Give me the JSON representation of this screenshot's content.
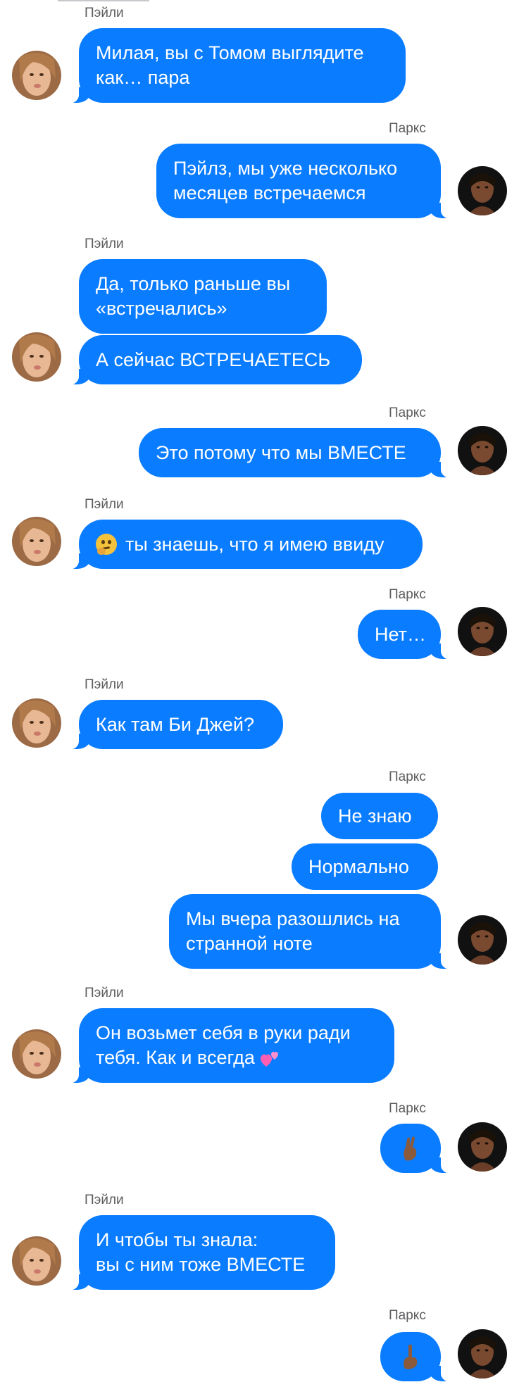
{
  "contacts": {
    "left_name": "Пэйли",
    "right_name": "Паркс"
  },
  "colors": {
    "bubble": "#0a7cff",
    "name_text": "#5c5c5f",
    "background": "#ffffff"
  },
  "messages": [
    {
      "sender": "Пэйли",
      "lines": [
        "Милая, вы с Томом выглядите",
        "как… пара"
      ]
    },
    {
      "sender": "Паркс",
      "lines": [
        "Пэйлз, мы уже несколько",
        "месяцев встречаемся"
      ]
    },
    {
      "sender": "Пэйли",
      "lines": [
        "Да, только раньше вы",
        "«встречались»"
      ]
    },
    {
      "sender": "Пэйли",
      "lines": [
        "А сейчас ВСТРЕЧАЕТЕСЬ"
      ]
    },
    {
      "sender": "Паркс",
      "lines": [
        "Это потому что мы ВМЕСТЕ"
      ]
    },
    {
      "sender": "Пэйли",
      "emoji": "thinking-face",
      "lines": [
        "ты знаешь, что я имею ввиду"
      ]
    },
    {
      "sender": "Паркс",
      "lines": [
        "Нет…"
      ]
    },
    {
      "sender": "Пэйли",
      "lines": [
        "Как там Би Джей?"
      ]
    },
    {
      "sender": "Паркс",
      "lines": [
        "Не знаю"
      ]
    },
    {
      "sender": "Паркс",
      "lines": [
        "Нормально"
      ]
    },
    {
      "sender": "Паркс",
      "lines": [
        "Мы вчера разошлись на",
        "странной ноте"
      ]
    },
    {
      "sender": "Пэйли",
      "lines": [
        "Он возьмет себя в руки ради",
        "тебя. Как и всегда"
      ],
      "emoji_after": "two-hearts"
    },
    {
      "sender": "Паркс",
      "emoji_only": "crossed-fingers"
    },
    {
      "sender": "Пэйли",
      "lines": [
        "И чтобы ты знала:",
        "вы с ним тоже ВМЕСТЕ"
      ]
    },
    {
      "sender": "Паркс",
      "emoji_only": "middle-finger"
    }
  ]
}
